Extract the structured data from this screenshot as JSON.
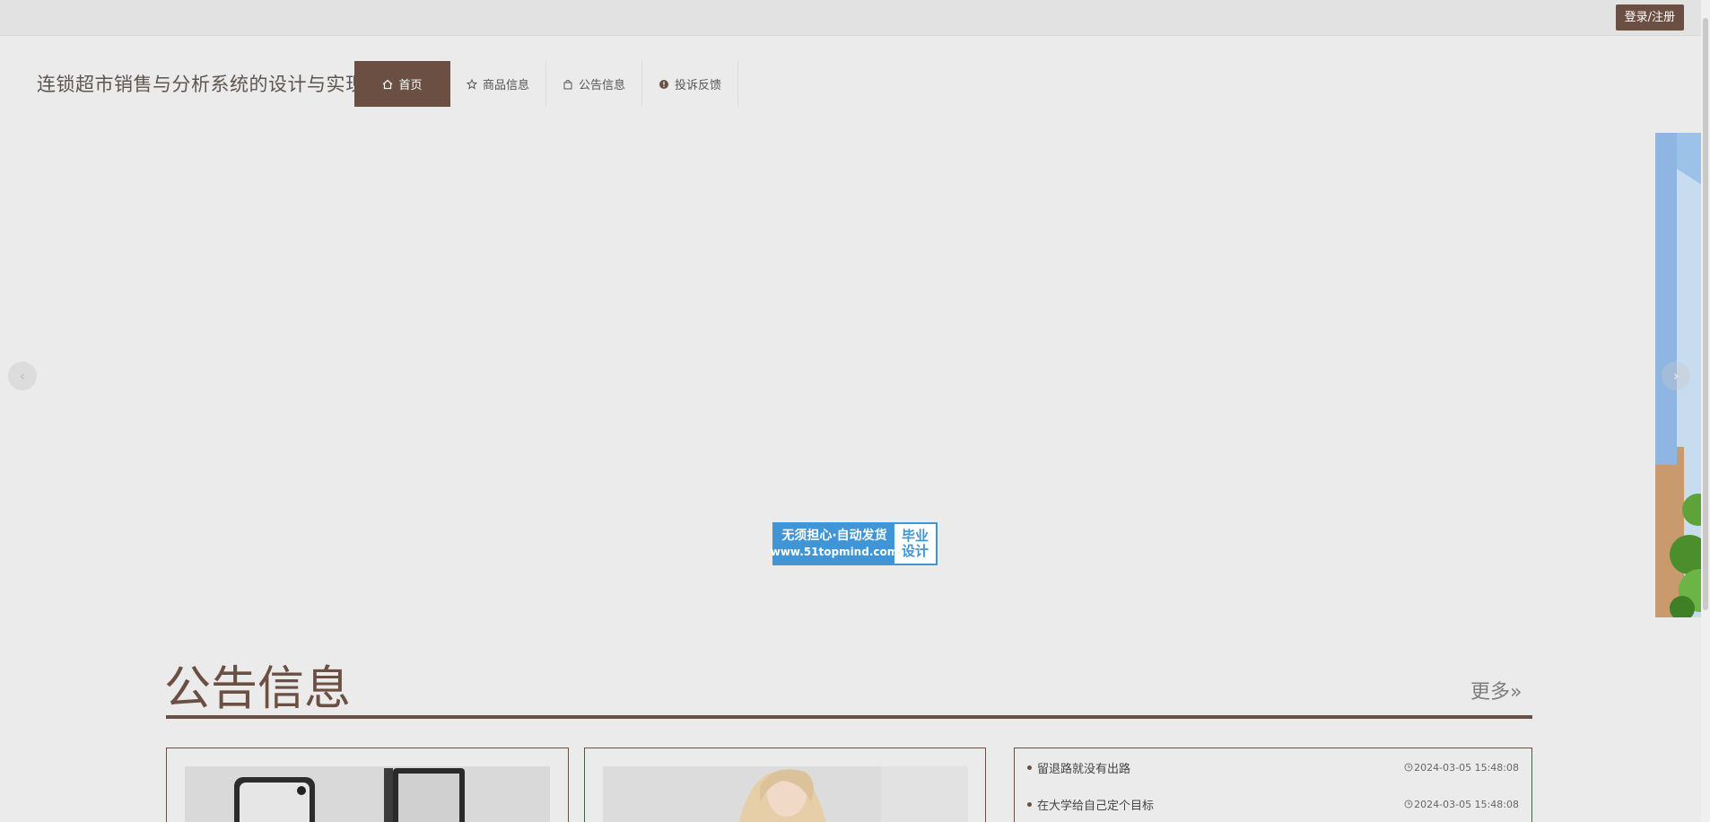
{
  "topbar": {
    "login_label": "登录/注册"
  },
  "site": {
    "title": "连锁超市销售与分析系统的设计与实现"
  },
  "nav": [
    {
      "label": "首页",
      "icon": "home-icon",
      "active": true
    },
    {
      "label": "商品信息",
      "icon": "star-icon"
    },
    {
      "label": "公告信息",
      "icon": "bag-icon"
    },
    {
      "label": "投诉反馈",
      "icon": "alert-icon"
    }
  ],
  "carousel": {
    "prev": "‹",
    "next": "›",
    "watermark": {
      "line1": "无须担心·自动发货",
      "line2": "www.51topmind.com",
      "right": "毕业设计"
    }
  },
  "notice": {
    "title": "公告信息",
    "more": "更多»",
    "list": [
      {
        "title": "留退路就没有出路",
        "time": "2024-03-05 15:48:08"
      },
      {
        "title": "在大学给自己定个目标",
        "time": "2024-03-05 15:48:08"
      }
    ]
  },
  "colors": {
    "brand": "#6b4f42",
    "background": "#ebebeb",
    "watermark_blue": "#3f95d6"
  }
}
